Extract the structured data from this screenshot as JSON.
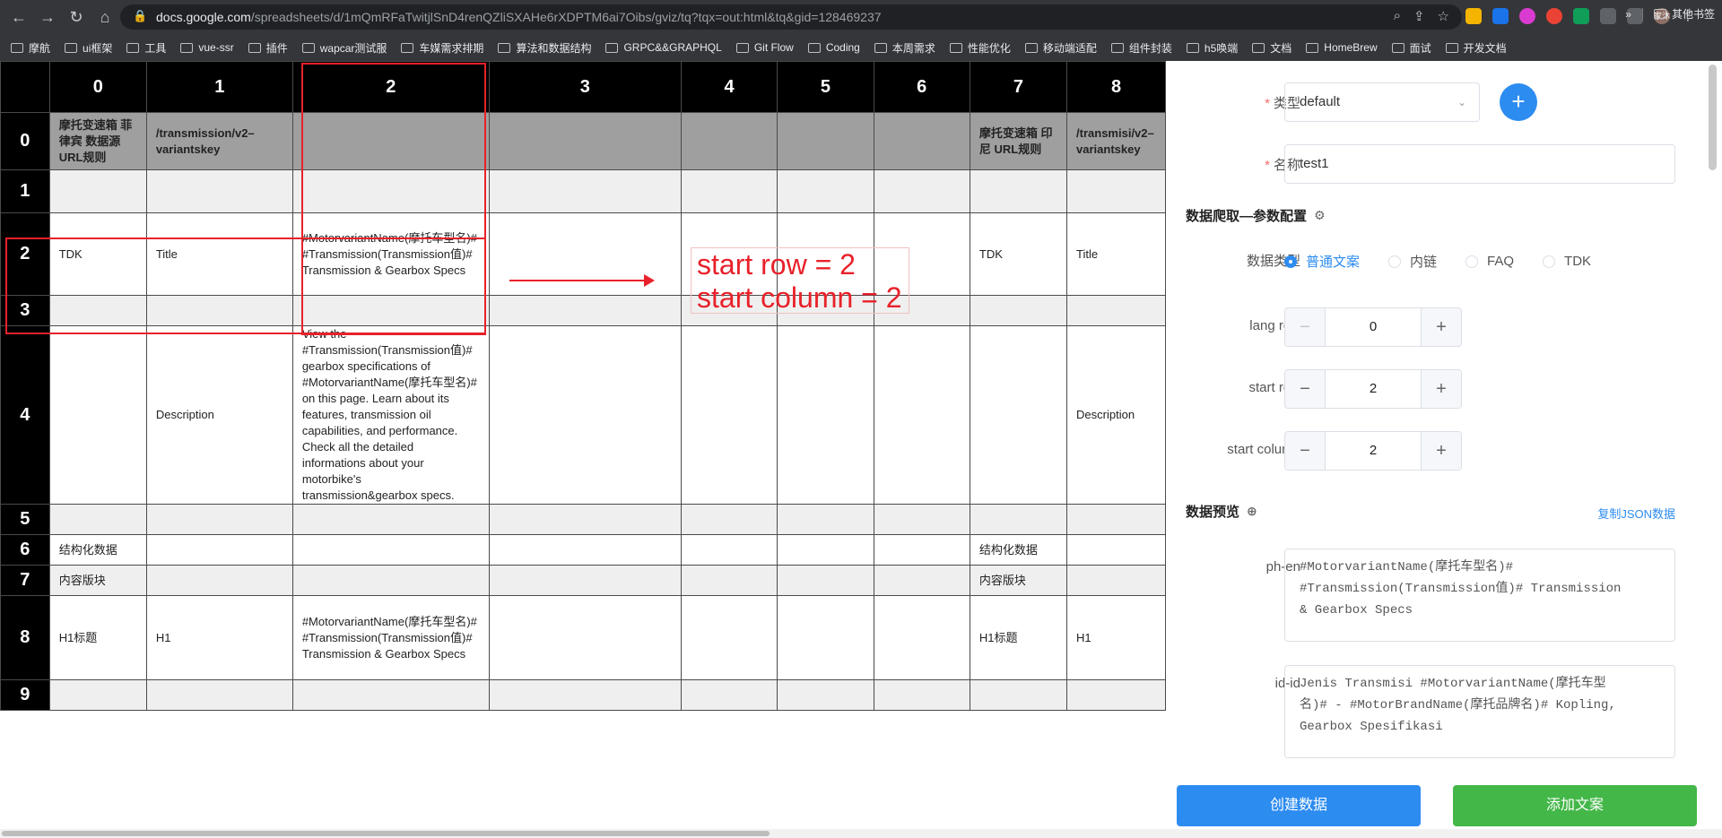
{
  "browser": {
    "url_domain": "docs.google.com",
    "url_path": "/spreadsheets/d/1mQmRFaTwitjlSnD4renQZliSXAHe6rXDPTM6ai7Oibs/gviz/tq?tqx=out:html&tq&gid=128469237",
    "avatar_text": "家沐",
    "bookmarks": [
      "摩航",
      "ui框架",
      "工具",
      "vue-ssr",
      "插件",
      "wapcar测试服",
      "车媒需求排期",
      "算法和数据结构",
      "GRPC&&GRAPHQL",
      "Git Flow",
      "Coding",
      "本周需求",
      "性能优化",
      "移动端适配",
      "组件封装",
      "h5唤端",
      "文档",
      "HomeBrew",
      "面试",
      "开发文档"
    ],
    "more_bookmarks": "»",
    "other_bookmarks": "其他书签"
  },
  "sheet": {
    "col_headers": [
      "0",
      "1",
      "2",
      "3",
      "4",
      "5",
      "6",
      "7",
      "8"
    ],
    "rows": [
      {
        "h": "0",
        "cells": [
          "摩托变速箱 菲律宾 数据源URL规则",
          "/transmission/v2–variantskey",
          "",
          "",
          "",
          "",
          "",
          "摩托变速箱 印尼 URL规则",
          "/transmisi/v2–variantskey"
        ]
      },
      {
        "h": "1",
        "cells": [
          "",
          "",
          "",
          "",
          "",
          "",
          "",
          "",
          ""
        ]
      },
      {
        "h": "2",
        "cells": [
          "TDK",
          "Title",
          "#MotorvariantName(摩托车型名)# #Transmission(Transmission值)# Transmission & Gearbox Specs",
          "",
          "",
          "",
          "",
          "TDK",
          "Title"
        ]
      },
      {
        "h": "3",
        "cells": [
          "",
          "",
          "",
          "",
          "",
          "",
          "",
          "",
          ""
        ]
      },
      {
        "h": "4",
        "cells": [
          "",
          "Description",
          "View the #Transmission(Transmission值)# gearbox specifications of #MotorvariantName(摩托车型名)# on this page. Learn about its features, transmission oil capabilities, and performance. Check all the detailed informations about your motorbike's transmission&gearbox specs.",
          "",
          "",
          "",
          "",
          "",
          "Description"
        ]
      },
      {
        "h": "5",
        "cells": [
          "",
          "",
          "",
          "",
          "",
          "",
          "",
          "",
          ""
        ]
      },
      {
        "h": "6",
        "cells": [
          "结构化数据",
          "",
          "",
          "",
          "",
          "",
          "",
          "结构化数据",
          ""
        ]
      },
      {
        "h": "7",
        "cells": [
          "内容版块",
          "",
          "",
          "",
          "",
          "",
          "",
          "内容版块",
          ""
        ]
      },
      {
        "h": "8",
        "cells": [
          "H1标题",
          "H1",
          "#MotorvariantName(摩托车型名)# #Transmission(Transmission值)# Transmission & Gearbox Specs",
          "",
          "",
          "",
          "",
          "H1标题",
          "H1"
        ]
      },
      {
        "h": "9",
        "cells": [
          "",
          "",
          "",
          "",
          "",
          "",
          "",
          "",
          ""
        ]
      }
    ],
    "annotation_line1": "start row = 2",
    "annotation_line2": "start column = 2"
  },
  "panel": {
    "type_label": "类型",
    "type_value": "default",
    "add_icon": "plus-icon",
    "name_label": "名称",
    "name_value": "test1",
    "crawl_section": "数据爬取—参数配置",
    "data_type_label": "数据类型",
    "data_type_options": [
      "普通文案",
      "内链",
      "FAQ",
      "TDK"
    ],
    "data_type_selected": "普通文案",
    "lang_row_label": "lang row",
    "lang_row_value": "0",
    "start_row_label": "start row",
    "start_row_value": "2",
    "start_column_label": "start column",
    "start_column_value": "2",
    "preview_section": "数据预览",
    "copy_json": "复制JSON数据",
    "preview_items": [
      {
        "lang": "ph-en",
        "text": "#MotorvariantName(摩托车型名)#\n#Transmission(Transmission值)# Transmission\n& Gearbox Specs"
      },
      {
        "lang": "id-id",
        "text": "Jenis Transmisi #MotorvariantName(摩托车型\n名)# - #MotorBrandName(摩托品牌名)# Kopling,\nGearbox Spesifikasi"
      }
    ],
    "create_button": "创建数据",
    "add_copy_button": "添加文案",
    "colors": {
      "primary": "#2d8cf0",
      "success": "#43b748",
      "danger": "#e8212a"
    }
  }
}
